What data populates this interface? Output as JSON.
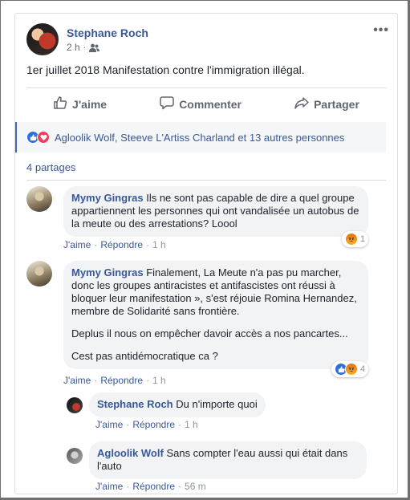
{
  "post": {
    "author": "Stephane Roch",
    "time": "2 h",
    "separator": "·",
    "text": "1er juillet 2018 Manifestation contre l'immigration illégal.",
    "more_label": "•••"
  },
  "actions": {
    "like": "J'aime",
    "comment": "Commenter",
    "share": "Partager"
  },
  "reactions": {
    "summary": "Agloolik Wolf, Steeve L'Artiss Charland et 13 autres personnes"
  },
  "shares_text": "4 partages",
  "colors": {
    "link": "#385898",
    "like_blue": "#2e6fe0",
    "love_red": "#f33e58",
    "bubble_bg": "#f2f3f5"
  },
  "comments": [
    {
      "author": "Mymy Gingras",
      "paragraphs": [
        "Ils ne sont pas capable de dire a quel groupe appartiennent les personnes qui ont vandalisée un autobus de la meute ou des arrestations? Loool"
      ],
      "like_label": "J'aime",
      "reply_label": "Répondre",
      "time": "1 h",
      "reaction_count": "1",
      "reaction_icons": [
        "angry-icon"
      ]
    },
    {
      "author": "Mymy Gingras",
      "paragraphs": [
        "Finalement, La Meute n'a pas pu marcher, donc les groupes antiracistes et antifascistes ont réussi à bloquer leur manifestation », s'est réjouie Romina Hernandez, membre de Solidarité sans frontière.",
        "Deplus il nous on empêcher davoir accès a nos pancartes...",
        "Cest pas antidémocratique ca ?"
      ],
      "like_label": "J'aime",
      "reply_label": "Répondre",
      "time": "1 h",
      "reaction_count": "4",
      "reaction_icons": [
        "like-icon",
        "angry-icon"
      ]
    }
  ],
  "replies": [
    {
      "author": "Stephane Roch",
      "text": "Du n'importe quoi",
      "like_label": "J'aime",
      "reply_label": "Répondre",
      "time": "1 h"
    },
    {
      "author": "Agloolik Wolf",
      "text": "Sans compter l'eau aussi qui était dans l'auto",
      "like_label": "J'aime",
      "reply_label": "Répondre",
      "time": "56 m"
    }
  ]
}
